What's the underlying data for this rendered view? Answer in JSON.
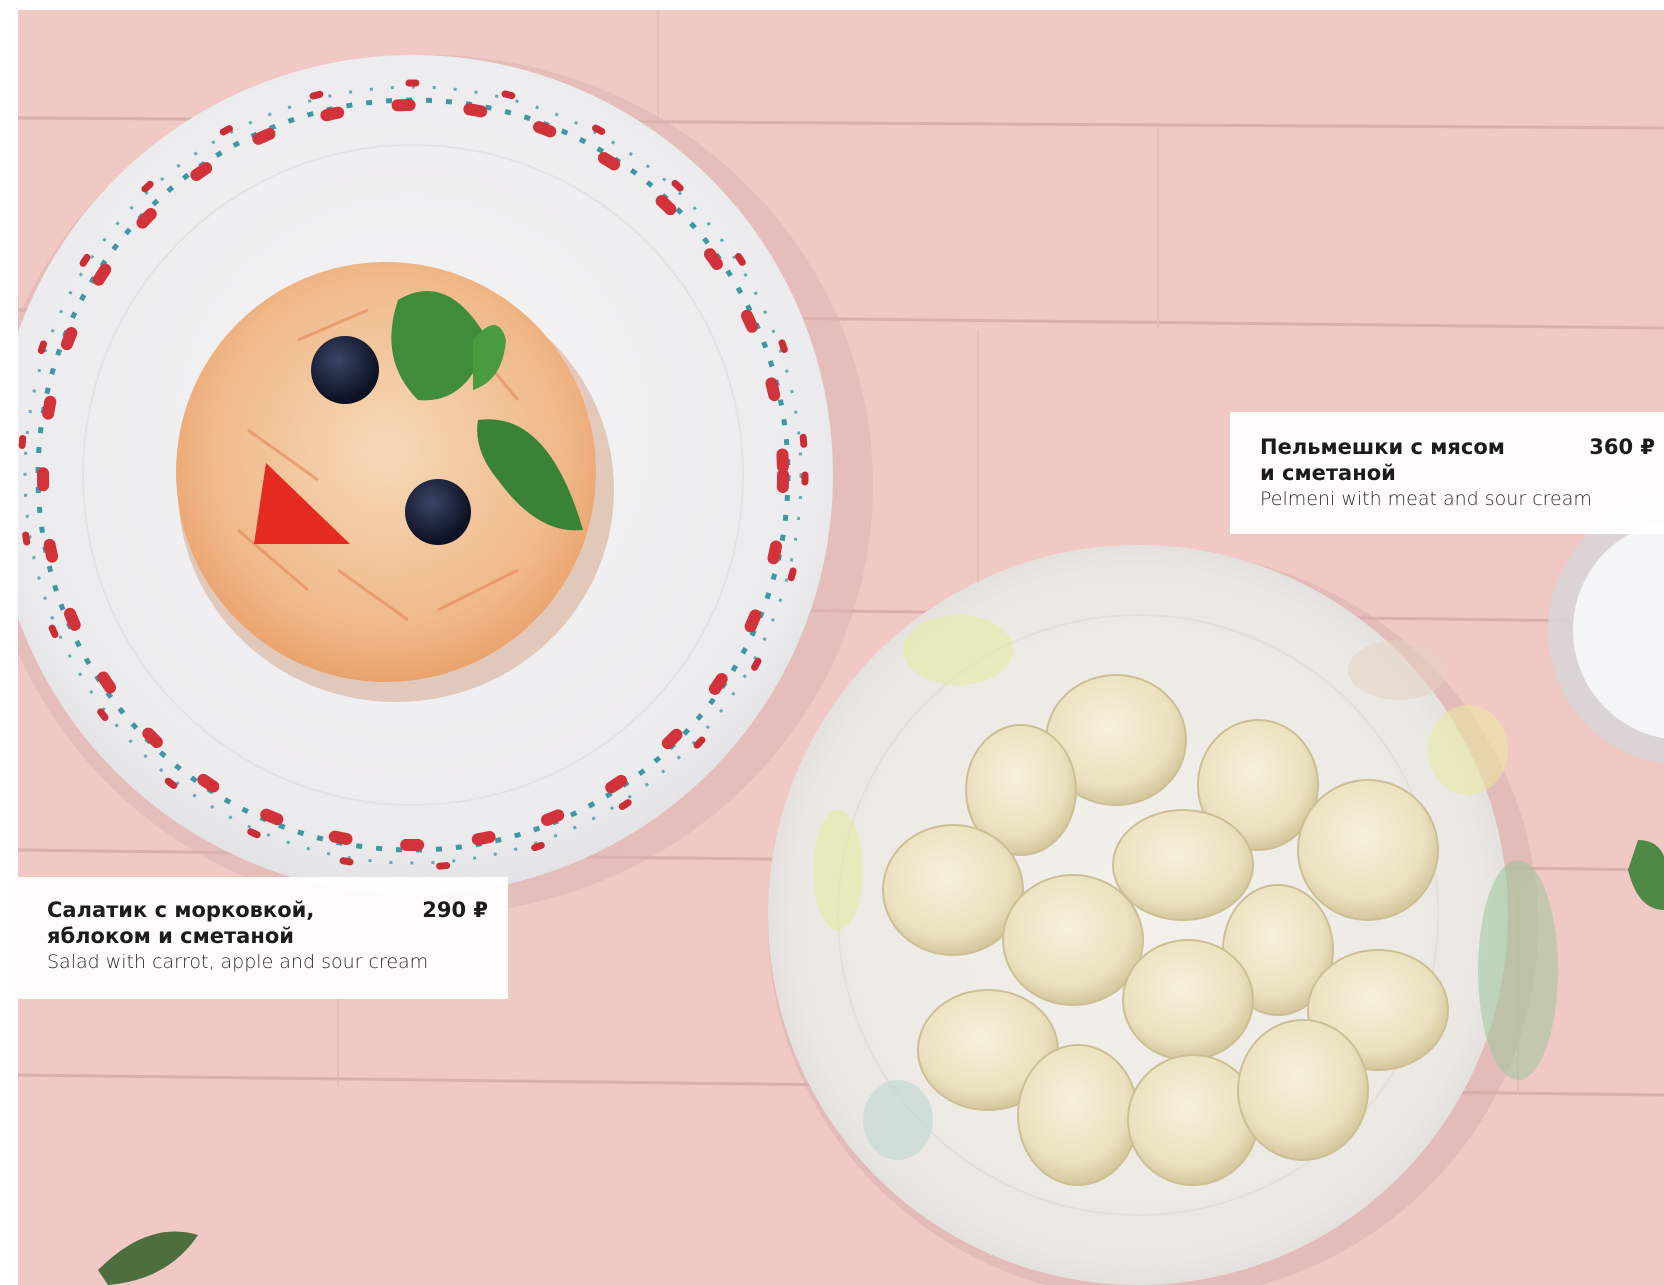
{
  "photo": {
    "description_icons": [
      "carrot-salad-plate",
      "pelmeni-bowl",
      "sour-cream-cup"
    ],
    "colors": {
      "table": "#f0c9c6",
      "plank_line": "#c99a96",
      "plate": "#f3f1f2",
      "flower_red": "#d2323a",
      "leaf_teal": "#2a8f9a",
      "dumpling": "#efe6c8"
    }
  },
  "menu_items": [
    {
      "name_line1": "Салатик с морковкой,",
      "name_line2": "яблоком и сметаной",
      "price": "290 ₽",
      "name_en": "Salad with carrot, apple and sour cream"
    },
    {
      "name_line1": "Пельмешки с мясом",
      "name_line2": "и сметаной",
      "price": "360 ₽",
      "name_en": "Pelmeni with meat and sour cream"
    }
  ]
}
